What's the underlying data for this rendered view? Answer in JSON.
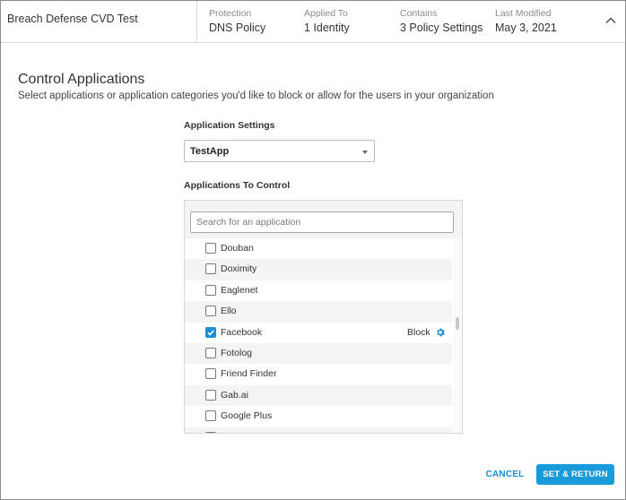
{
  "header": {
    "policy_name": "Breach Defense CVD Test",
    "protection": {
      "label": "Protection",
      "value": "DNS Policy"
    },
    "applied_to": {
      "label": "Applied To",
      "value": "1 Identity"
    },
    "contains": {
      "label": "Contains",
      "value": "3 Policy Settings"
    },
    "last_modified": {
      "label": "Last Modified",
      "value": "May 3, 2021"
    },
    "collapse_icon": "chevron-up-icon"
  },
  "content": {
    "title": "Control Applications",
    "description": "Select applications or application categories you'd like to block or allow for the users in your organization"
  },
  "app_settings": {
    "label": "Application Settings",
    "selected": "TestApp"
  },
  "apps_to_control": {
    "label": "Applications To Control",
    "search_placeholder": "Search for an application",
    "items": [
      {
        "name": "Douban",
        "checked": false,
        "action": ""
      },
      {
        "name": "Doximity",
        "checked": false,
        "action": ""
      },
      {
        "name": "Eaglenet",
        "checked": false,
        "action": ""
      },
      {
        "name": "Ello",
        "checked": false,
        "action": ""
      },
      {
        "name": "Facebook",
        "checked": true,
        "action": "Block"
      },
      {
        "name": "Fotolog",
        "checked": false,
        "action": ""
      },
      {
        "name": "Friend Finder",
        "checked": false,
        "action": ""
      },
      {
        "name": "Gab.ai",
        "checked": false,
        "action": ""
      },
      {
        "name": "Google Plus",
        "checked": false,
        "action": ""
      },
      {
        "name": "",
        "checked": false,
        "action": ""
      }
    ]
  },
  "footer": {
    "cancel_label": "CANCEL",
    "submit_label": "SET & RETURN"
  },
  "colors": {
    "accent": "#1a9ad9",
    "row_shade": "#f4f4f4"
  }
}
